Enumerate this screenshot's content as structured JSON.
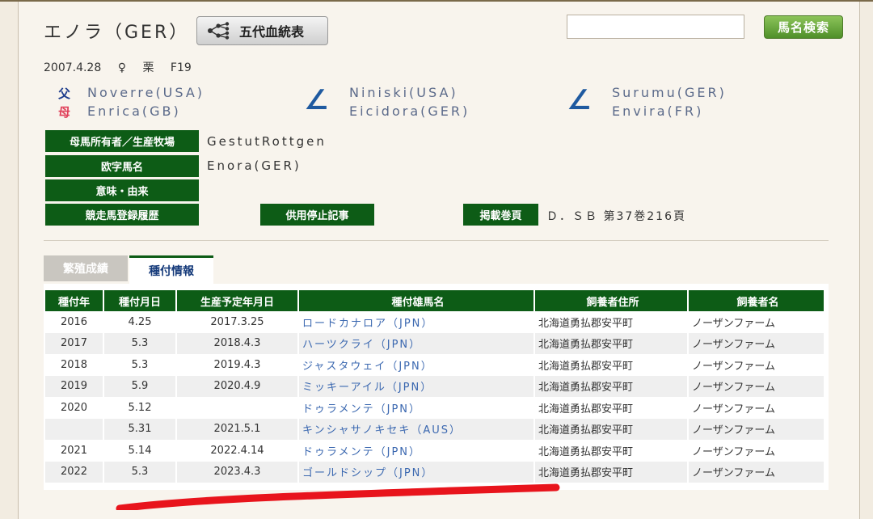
{
  "horse": {
    "name": "エノラ（GER）",
    "pedigree_button": "五代血統表",
    "birth_date": "2007.4.28",
    "sex": "♀",
    "color": "栗",
    "family": "F19"
  },
  "search": {
    "placeholder": "",
    "button": "馬名検索"
  },
  "pedigree": {
    "father_label": "父",
    "mother_label": "母",
    "sire": "Noverre(USA)",
    "dam": "Enrica(GB)",
    "sire_sire": "Niniski(USA)",
    "sire_dam": "Eicidora(GER)",
    "dam_sire": "Surumu(GER)",
    "dam_dam": "Envira(FR)",
    "arrow": "∠"
  },
  "info": {
    "owner_label": "母馬所有者／生産牧場",
    "owner_value": "GestutRottgen",
    "roman_label": "欧字馬名",
    "roman_value": "Enora(GER)",
    "meaning_label": "意味・由来",
    "race_label": "競走馬登録履歴",
    "retire_label": "供用停止記事",
    "page_label": "掲載巻頁",
    "page_value": "Ｄ．ＳＢ 第37巻216頁"
  },
  "tabs": {
    "breeding": "繁殖成績",
    "mating": "種付情報"
  },
  "table": {
    "headers": [
      "種付年",
      "種付月日",
      "生産予定年月日",
      "種付雄馬名",
      "飼養者住所",
      "飼養者名"
    ],
    "rows": [
      {
        "year": "2016",
        "date": "4.25",
        "birth": "2017.3.25",
        "sire": "ロードカナロア（JPN）",
        "addr": "北海道勇払郡安平町",
        "owner": "ノーザンファーム"
      },
      {
        "year": "2017",
        "date": "5.3",
        "birth": "2018.4.3",
        "sire": "ハーツクライ（JPN）",
        "addr": "北海道勇払郡安平町",
        "owner": "ノーザンファーム"
      },
      {
        "year": "2018",
        "date": "5.3",
        "birth": "2019.4.3",
        "sire": "ジャスタウェイ（JPN）",
        "addr": "北海道勇払郡安平町",
        "owner": "ノーザンファーム"
      },
      {
        "year": "2019",
        "date": "5.9",
        "birth": "2020.4.9",
        "sire": "ミッキーアイル（JPN）",
        "addr": "北海道勇払郡安平町",
        "owner": "ノーザンファーム"
      },
      {
        "year": "2020",
        "date": "5.12",
        "birth": "",
        "sire": "ドゥラメンテ（JPN）",
        "addr": "北海道勇払郡安平町",
        "owner": "ノーザンファーム"
      },
      {
        "year": "",
        "date": "5.31",
        "birth": "2021.5.1",
        "sire": "キンシャサノキセキ（AUS）",
        "addr": "北海道勇払郡安平町",
        "owner": "ノーザンファーム"
      },
      {
        "year": "2021",
        "date": "5.14",
        "birth": "2022.4.14",
        "sire": "ドゥラメンテ（JPN）",
        "addr": "北海道勇払郡安平町",
        "owner": "ノーザンファーム"
      },
      {
        "year": "2022",
        "date": "5.3",
        "birth": "2023.4.3",
        "sire": "ゴールドシップ（JPN）",
        "addr": "北海道勇払郡安平町",
        "owner": "ノーザンファーム"
      }
    ]
  },
  "colors": {
    "header_green": "#0d5c16",
    "link_blue": "#3b68b0",
    "annotation_red": "#e8141c"
  }
}
